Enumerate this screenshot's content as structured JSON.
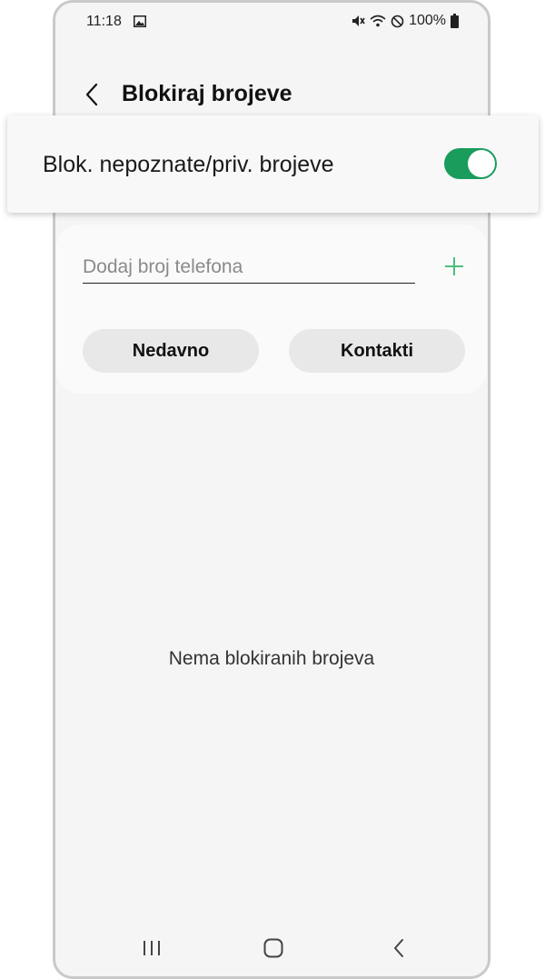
{
  "status_bar": {
    "time": "11:18",
    "battery": "100%",
    "icons": [
      "gallery-icon",
      "mute-icon",
      "wifi-icon",
      "do-not-disturb-icon",
      "battery-icon"
    ]
  },
  "header": {
    "title": "Blokiraj brojeve",
    "back_icon": "chevron-left-icon"
  },
  "block_unknown": {
    "label": "Blok. nepoznate/priv. brojeve",
    "enabled": true,
    "accent_color": "#1a9c5c"
  },
  "add_number": {
    "placeholder": "Dodaj broj telefona",
    "value": "",
    "add_icon": "plus-icon",
    "add_icon_color": "#4cbf7f"
  },
  "buttons": {
    "recent": "Nedavno",
    "contacts": "Kontakti"
  },
  "empty_state": "Nema blokiranih brojeva",
  "nav_bar": {
    "icons": [
      "recents-icon",
      "home-icon",
      "back-icon"
    ]
  }
}
